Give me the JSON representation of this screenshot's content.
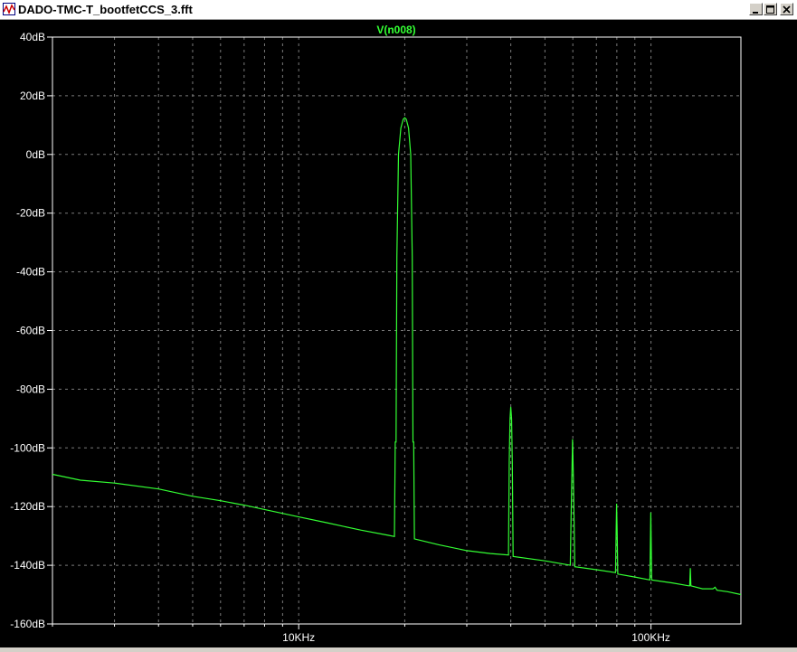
{
  "window": {
    "title": "DADO-TMC-T_bootfetCCS_3.fft",
    "controls": {
      "minimize": "minimize-icon",
      "maximize": "maximize-icon",
      "close": "close-icon"
    }
  },
  "colors": {
    "background": "#000000",
    "trace": "#33ff33",
    "grid": "#7a7a7a",
    "axis_text": "#ffffff",
    "border": "#ffffff"
  },
  "chart_data": {
    "type": "line",
    "title": "V(n008)",
    "x_scale": "log",
    "xlim": [
      2000,
      180000
    ],
    "ylim": [
      -160,
      40
    ],
    "y_ticks": [
      {
        "value": 40,
        "label": "40dB"
      },
      {
        "value": 20,
        "label": "20dB"
      },
      {
        "value": 0,
        "label": "0dB"
      },
      {
        "value": -20,
        "label": "-20dB"
      },
      {
        "value": -40,
        "label": "-40dB"
      },
      {
        "value": -60,
        "label": "-60dB"
      },
      {
        "value": -80,
        "label": "-80dB"
      },
      {
        "value": -100,
        "label": "-100dB"
      },
      {
        "value": -120,
        "label": "-120dB"
      },
      {
        "value": -140,
        "label": "-140dB"
      },
      {
        "value": -160,
        "label": "-160dB"
      }
    ],
    "x_ticks": [
      {
        "value": 10000,
        "label": "10KHz"
      },
      {
        "value": 100000,
        "label": "100KHz"
      }
    ],
    "grid": true,
    "series": [
      {
        "points": [
          [
            2000,
            -109
          ],
          [
            2400,
            -111
          ],
          [
            3000,
            -112
          ],
          [
            4000,
            -114
          ],
          [
            5000,
            -116.5
          ],
          [
            6000,
            -118
          ],
          [
            7000,
            -119.5
          ],
          [
            8000,
            -121
          ],
          [
            10000,
            -123.5
          ],
          [
            12000,
            -125.5
          ],
          [
            15000,
            -128
          ],
          [
            18000,
            -129.8
          ],
          [
            18700,
            -130.2
          ],
          [
            18800,
            -98
          ],
          [
            18900,
            -98
          ],
          [
            19000,
            -35
          ],
          [
            19200,
            0
          ],
          [
            19500,
            9
          ],
          [
            19800,
            12
          ],
          [
            20000,
            12.5
          ],
          [
            20200,
            12
          ],
          [
            20500,
            9
          ],
          [
            20800,
            0
          ],
          [
            21000,
            -35
          ],
          [
            21100,
            -98
          ],
          [
            21200,
            -98
          ],
          [
            21300,
            -131
          ],
          [
            25000,
            -133
          ],
          [
            30000,
            -135
          ],
          [
            35000,
            -136
          ],
          [
            39400,
            -136.5
          ],
          [
            39600,
            -105
          ],
          [
            39800,
            -90
          ],
          [
            40000,
            -86
          ],
          [
            40200,
            -90
          ],
          [
            40400,
            -105
          ],
          [
            40600,
            -137
          ],
          [
            50000,
            -138.5
          ],
          [
            59000,
            -140
          ],
          [
            59300,
            -125
          ],
          [
            59600,
            -110
          ],
          [
            59900,
            -97
          ],
          [
            60200,
            -110
          ],
          [
            60500,
            -125
          ],
          [
            60800,
            -140.5
          ],
          [
            70000,
            -141.5
          ],
          [
            79300,
            -142.5
          ],
          [
            79600,
            -130
          ],
          [
            79900,
            -119
          ],
          [
            80200,
            -130
          ],
          [
            80500,
            -143
          ],
          [
            90000,
            -144
          ],
          [
            99300,
            -145
          ],
          [
            99600,
            -134
          ],
          [
            99900,
            -122
          ],
          [
            100200,
            -134
          ],
          [
            100500,
            -145
          ],
          [
            115000,
            -146
          ],
          [
            128000,
            -147
          ],
          [
            128800,
            -147
          ],
          [
            129300,
            -141
          ],
          [
            129800,
            -147
          ],
          [
            140000,
            -148
          ],
          [
            150000,
            -148
          ],
          [
            152000,
            -147.5
          ],
          [
            154000,
            -148.5
          ],
          [
            165000,
            -149
          ],
          [
            180000,
            -150
          ]
        ]
      }
    ]
  }
}
